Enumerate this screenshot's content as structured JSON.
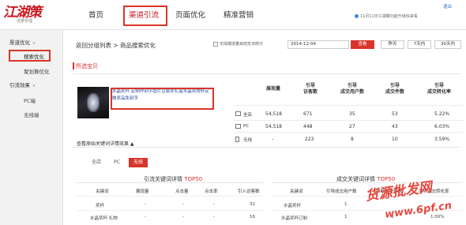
{
  "logo": {
    "main": "江湖策",
    "sub": "流量管理"
  },
  "nav": {
    "items": [
      {
        "label": "首页",
        "active": false
      },
      {
        "label": "渠道引流",
        "active": true
      },
      {
        "label": "页面优化",
        "active": false
      },
      {
        "label": "精准营销",
        "active": false
      }
    ]
  },
  "header": {
    "user_link": "退出",
    "notice": "11月11日江湖策功能升级快来看"
  },
  "sidebar": {
    "group1": "渠道优化",
    "item_search": "搜索优化",
    "item_aggregate": "聚划算优化",
    "group2": "引流效果",
    "item_pc": "PC端",
    "item_wireless": "无线端"
  },
  "breadcrumb": "返回分组列表 > 商品搜索优化",
  "toolbar": {
    "checkbox_label": "无线端流量目前无法统计",
    "date": "2014-12-04",
    "query": "查看",
    "range_yesterday": "昨天",
    "range_7": "7天内",
    "range_30": "30天内"
  },
  "section": {
    "title": "所选宝贝"
  },
  "product": {
    "title": "水晶奖杯 定制作刻字图片豆腐奖礼盒水晶奖牌杯定做奖品免刻字"
  },
  "table": {
    "headers": [
      "展现量",
      "引导\n访客数",
      "引导\n成交用户数",
      "引导\n成交件数",
      "引导\n成交转化率"
    ],
    "rows": [
      {
        "device": "全店",
        "values": [
          "54,518",
          "671",
          "35",
          "53",
          "5.22%"
        ]
      },
      {
        "device": "PC",
        "values": [
          "54,518",
          "448",
          "27",
          "43",
          "6.03%"
        ]
      },
      {
        "device": "无线",
        "values": [
          "-",
          "223",
          "8",
          "10",
          "3.59%"
        ]
      }
    ]
  },
  "toggle_keywords": "查看原始关键词详情效果 ▲",
  "tabs": [
    {
      "label": "全店",
      "active": false
    },
    {
      "label": "PC",
      "active": false
    },
    {
      "label": "无线",
      "active": true
    }
  ],
  "left_panel": {
    "title": "引流关键词详情",
    "top": "TOP50",
    "headers": [
      "关键词",
      "展现量",
      "点击量",
      "点击率",
      "引入访客数"
    ],
    "rows": [
      [
        "奖杯",
        "-",
        "-",
        "-",
        "32"
      ],
      [
        "水晶奖杯 礼物",
        "-",
        "-",
        "-",
        "16"
      ]
    ]
  },
  "right_panel": {
    "title": "成交关键词详情",
    "top": "TOP50",
    "headers": [
      "关键词",
      "引导成交用户数",
      "引导成交件数",
      "引导成交转化率"
    ],
    "rows": [
      [
        "水晶奖杯",
        "1",
        "",
        ""
      ],
      [
        "水晶奖杯订制",
        "1",
        "3",
        "1.00%"
      ]
    ]
  },
  "watermark": {
    "line1": "货源批发网",
    "line2": "www.6pf.cn"
  }
}
